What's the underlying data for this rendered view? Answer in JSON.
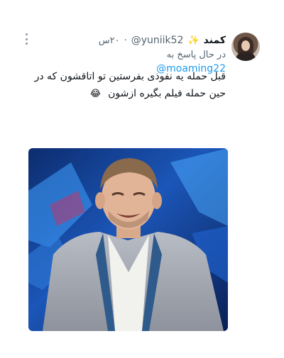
{
  "tweet": {
    "display_name": "کمند",
    "badge_icon": "sparkle-icon",
    "handle": "@yuniik52",
    "separator": "·",
    "time": "۲۰س",
    "reply_prefix": "در حال پاسخ به",
    "mention": "@moaming22",
    "text": "قبل حمله یه نفوذی بفرستین تو اتاقشون که در حین حمله فیلم بگیره ازشون",
    "emoji": "😂",
    "more_icon": "more-vertical-icon"
  },
  "colors": {
    "link": "#1d9bf0",
    "secondary_text": "#536471",
    "primary_text": "#0f1419",
    "background": "#ffffff"
  }
}
